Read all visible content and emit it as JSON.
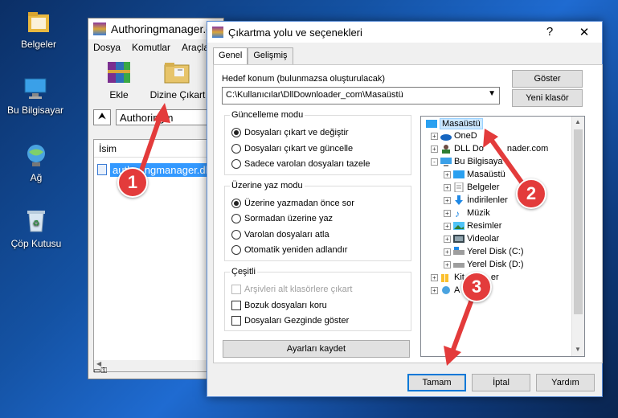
{
  "desktop": {
    "icons": [
      {
        "label": "Belgeler",
        "icon": "documents-folder-icon"
      },
      {
        "label": "Bu Bilgisayar",
        "icon": "computer-icon"
      },
      {
        "label": "Ağ",
        "icon": "network-icon"
      },
      {
        "label": "Çöp Kutusu",
        "icon": "recycle-bin-icon"
      }
    ]
  },
  "winrar": {
    "title": "Authoringmanager.dl",
    "menu": [
      "Dosya",
      "Komutlar",
      "Araçla"
    ],
    "toolbar": {
      "add": "Ekle",
      "extract_to": "Dizine Çıkart"
    },
    "address": "Authoringm",
    "list_header": "İsim",
    "file": "authoringmanager.dl"
  },
  "dialog": {
    "title": "Çıkartma yolu ve seçenekleri",
    "help_btn": "?",
    "close_btn": "✕",
    "tabs": [
      "Genel",
      "Gelişmiş"
    ],
    "dest_label": "Hedef konum (bulunmazsa oluşturulacak)",
    "dest_value": "C:\\Kullanıcılar\\DllDownloader_com\\Masaüstü",
    "show_btn": "Göster",
    "new_folder_btn": "Yeni klasör",
    "update_mode": {
      "title": "Güncelleme modu",
      "options": [
        "Dosyaları çıkart ve değiştir",
        "Dosyaları çıkart ve güncelle",
        "Sadece varolan dosyaları tazele"
      ],
      "selected": 0
    },
    "overwrite_mode": {
      "title": "Üzerine yaz modu",
      "options": [
        "Üzerine yazmadan önce sor",
        "Sormadan üzerine yaz",
        "Varolan dosyaları atla",
        "Otomatik yeniden adlandır"
      ],
      "selected": 0
    },
    "misc": {
      "title": "Çeşitli",
      "options": [
        {
          "label": "Arşivleri alt klasörlere çıkart",
          "checked": false,
          "disabled": true
        },
        {
          "label": "Bozuk dosyaları koru",
          "checked": false,
          "disabled": false
        },
        {
          "label": "Dosyaları Gezginde göster",
          "checked": false,
          "disabled": false
        }
      ]
    },
    "save_settings_btn": "Ayarları kaydet",
    "tree": [
      {
        "label": "Masaüstü",
        "icon": "desktop-icon",
        "level": 0,
        "selected": true
      },
      {
        "label": "OneD",
        "icon": "onedrive-icon",
        "level": 1,
        "expander": "+"
      },
      {
        "label": "DLL Do",
        "tail": "nader.com",
        "icon": "user-icon",
        "level": 1,
        "expander": "+"
      },
      {
        "label": "Bu Bilgisaya",
        "icon": "computer-icon",
        "level": 1,
        "expander": "-"
      },
      {
        "label": "Masaüstü",
        "icon": "desktop-icon",
        "level": 2,
        "expander": "+"
      },
      {
        "label": "Belgeler",
        "icon": "documents-icon",
        "level": 2,
        "expander": "+"
      },
      {
        "label": "İndirilenler",
        "icon": "download-icon",
        "level": 2,
        "expander": "+"
      },
      {
        "label": "Müzik",
        "icon": "music-icon",
        "level": 2,
        "expander": "+"
      },
      {
        "label": "Resimler",
        "icon": "pictures-icon",
        "level": 2,
        "expander": "+"
      },
      {
        "label": "Videolar",
        "icon": "videos-icon",
        "level": 2,
        "expander": "+"
      },
      {
        "label": "Yerel Disk (C:)",
        "icon": "drive-icon",
        "level": 2,
        "expander": "+"
      },
      {
        "label": "Yerel Disk (D:)",
        "icon": "drive-icon",
        "level": 2,
        "expander": "+"
      },
      {
        "label": "Kit",
        "tail": "er",
        "icon": "library-icon",
        "level": 1,
        "expander": "+"
      },
      {
        "label": "A",
        "icon": "network-icon",
        "level": 1,
        "expander": "+"
      }
    ],
    "ok_btn": "Tamam",
    "cancel_btn": "İptal",
    "help_button": "Yardım"
  },
  "annotations": [
    {
      "number": "1",
      "color": "#e33b3b"
    },
    {
      "number": "2",
      "color": "#e33b3b"
    },
    {
      "number": "3",
      "color": "#e33b3b"
    }
  ]
}
